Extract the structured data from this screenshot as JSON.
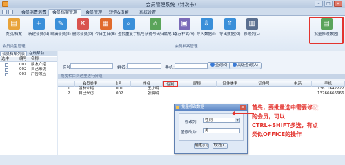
{
  "window": {
    "title": "会员管理系统（计次卡）"
  },
  "ribbon_tabs": [
    "会员消费消费",
    "会员档案管理",
    "会员管理",
    "短信&提醒",
    "系统设置"
  ],
  "ribbon_buttons": [
    {
      "label": "类别/档案",
      "icon": "folder-icon",
      "color": "#e8a33a"
    },
    {
      "label": "新建会员(N)",
      "icon": "add-user-icon",
      "color": "#3a8fd9"
    },
    {
      "label": "编辑会员(E)",
      "icon": "edit-user-icon",
      "color": "#3a8fd9"
    },
    {
      "label": "删除会员(D)",
      "icon": "delete-user-icon",
      "color": "#d9534f"
    },
    {
      "label": "今日生日(B)",
      "icon": "calendar-icon",
      "color": "#e06b2d"
    },
    {
      "label": "查找重复手机号",
      "icon": "find-duplicate-icon",
      "color": "#3a8fd9"
    },
    {
      "label": "获得号码归属地(L)",
      "icon": "location-icon",
      "color": "#5aa45a"
    },
    {
      "label": "保存样式(Y)",
      "icon": "save-style-icon",
      "color": "#7b6bb8"
    },
    {
      "label": "导入数据(I)",
      "icon": "import-icon",
      "color": "#3a8fd9"
    },
    {
      "label": "导出数据(O)",
      "icon": "export-icon",
      "color": "#3a8fd9"
    },
    {
      "label": "修改列(L)",
      "icon": "modify-columns-icon",
      "color": "#5a6f90"
    },
    {
      "label": "批量修改数据(",
      "icon": "batch-edit-icon",
      "color": "#5aa45a"
    }
  ],
  "ribbon_groups": {
    "left": "会员类型管理",
    "right": "会员档案管理"
  },
  "left_panel": {
    "tabs": [
      "会员档案列表",
      "在线帮助"
    ],
    "headers": [
      "选中",
      "编号",
      "名称"
    ],
    "rows": [
      {
        "id": "001",
        "name": "朋友介绍"
      },
      {
        "id": "002",
        "name": "自己来访"
      },
      {
        "id": "003",
        "name": "广告效应"
      }
    ]
  },
  "filter": {
    "card_label": "卡号:",
    "name_label": "姓名:",
    "phone_label": "手机:",
    "query_button": "查询(Q)",
    "advanced_button": "高级查询(A)"
  },
  "group_hint": "拖曳栏目到这里进行分组",
  "grid": {
    "columns": [
      "会员类型",
      "卡号",
      "姓名",
      "性别",
      "昵称",
      "证件类型",
      "证件号",
      "电话",
      "手机"
    ],
    "rows": [
      {
        "num": "1",
        "type": "朋友介绍",
        "card": "001",
        "name": "王小明",
        "gender": "",
        "mobile": "13611642222"
      },
      {
        "num": "2",
        "type": "自己来访",
        "card": "002",
        "name": "张晓明",
        "gender": "",
        "mobile": "13766666666"
      }
    ]
  },
  "dialog": {
    "title": "批量修改数据",
    "close": "x",
    "column_label": "修改列:",
    "column_value": "性别",
    "value_label": "值修改为:",
    "value_value": "男",
    "ok": "确定(O)",
    "cancel": "取消(C)"
  },
  "annotation": {
    "line1": "首先，要批量选中需要修",
    "line1_highlight": "改",
    "line2": "的会员，可以",
    "line3": "CTRL+SHIFT多选，有点",
    "line4": "类似OFFICE的操作"
  }
}
